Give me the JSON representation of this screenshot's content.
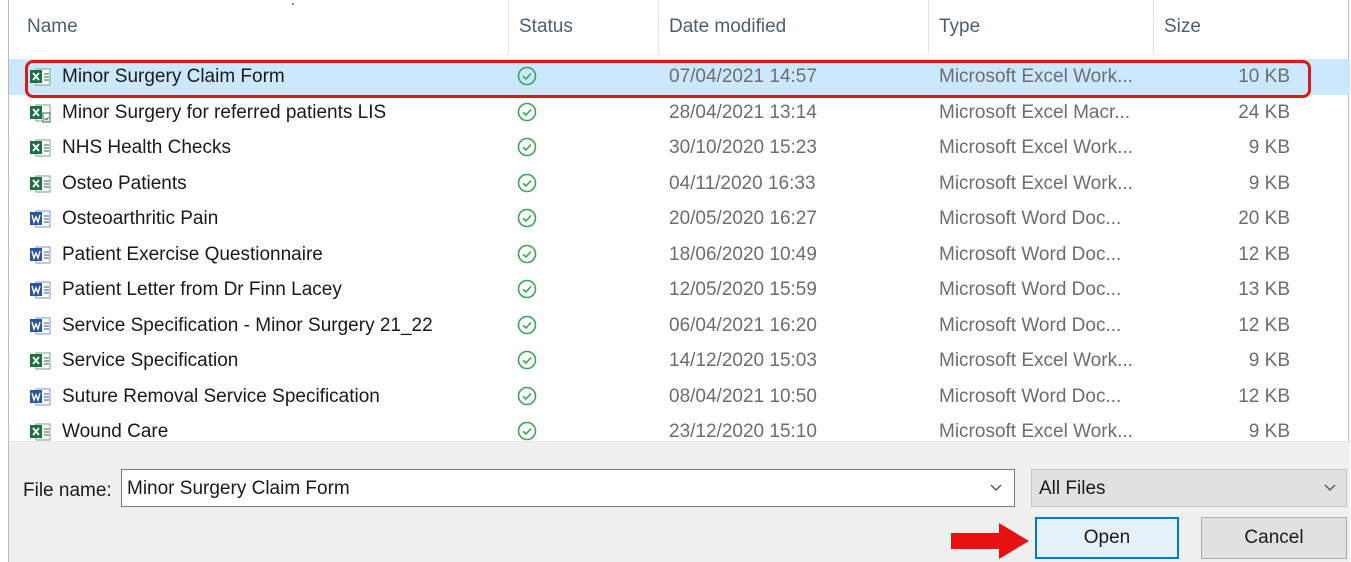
{
  "columns": {
    "name": "Name",
    "status": "Status",
    "date_modified": "Date modified",
    "type": "Type",
    "size": "Size"
  },
  "files": [
    {
      "name": "Minor Surgery Claim Form",
      "icon": "excel-file-icon",
      "status": "synced-check-icon",
      "date": "07/04/2021 14:57",
      "type": "Microsoft Excel Work...",
      "size": "10 KB",
      "selected": true
    },
    {
      "name": "Minor Surgery for referred patients LIS",
      "icon": "excel-macro-file-icon",
      "status": "synced-check-icon",
      "date": "28/04/2021 13:14",
      "type": "Microsoft Excel Macr...",
      "size": "24 KB"
    },
    {
      "name": "NHS Health Checks",
      "icon": "excel-file-icon",
      "status": "synced-check-icon",
      "date": "30/10/2020 15:23",
      "type": "Microsoft Excel Work...",
      "size": "9 KB"
    },
    {
      "name": "Osteo Patients",
      "icon": "excel-file-icon",
      "status": "synced-check-icon",
      "date": "04/11/2020 16:33",
      "type": "Microsoft Excel Work...",
      "size": "9 KB"
    },
    {
      "name": "Osteoarthritic Pain",
      "icon": "word-file-icon",
      "status": "synced-check-icon",
      "date": "20/05/2020 16:27",
      "type": "Microsoft Word Doc...",
      "size": "20 KB"
    },
    {
      "name": "Patient Exercise Questionnaire",
      "icon": "word-file-icon",
      "status": "synced-check-icon",
      "date": "18/06/2020 10:49",
      "type": "Microsoft Word Doc...",
      "size": "12 KB"
    },
    {
      "name": "Patient Letter from Dr Finn Lacey",
      "icon": "word-file-icon",
      "status": "synced-check-icon",
      "date": "12/05/2020 15:59",
      "type": "Microsoft Word Doc...",
      "size": "13 KB"
    },
    {
      "name": "Service Specification - Minor Surgery 21_22",
      "icon": "word-file-icon",
      "status": "synced-check-icon",
      "date": "06/04/2021 16:20",
      "type": "Microsoft Word Doc...",
      "size": "12 KB"
    },
    {
      "name": "Service Specification",
      "icon": "excel-file-icon",
      "status": "synced-check-icon",
      "date": "14/12/2020 15:03",
      "type": "Microsoft Excel Work...",
      "size": "9 KB"
    },
    {
      "name": "Suture Removal Service Specification",
      "icon": "word-file-icon",
      "status": "synced-check-icon",
      "date": "08/04/2021 10:50",
      "type": "Microsoft Word Doc...",
      "size": "12 KB"
    },
    {
      "name": "Wound Care",
      "icon": "excel-file-icon",
      "status": "synced-check-icon",
      "date": "23/12/2020 15:10",
      "type": "Microsoft Excel Work...",
      "size": "9 KB"
    }
  ],
  "footer": {
    "file_name_label": "File name:",
    "file_name_value": "Minor Surgery Claim Form",
    "filter_value": "All Files",
    "open_label": "Open",
    "cancel_label": "Cancel"
  },
  "colors": {
    "selection": "#cce8ff",
    "highlight_border": "#d91a1a",
    "excel_green": "#1d7044",
    "word_blue": "#2b579a",
    "status_green": "#3aa655",
    "primary_button_border": "#0078d7",
    "arrow_red": "#e81010"
  }
}
